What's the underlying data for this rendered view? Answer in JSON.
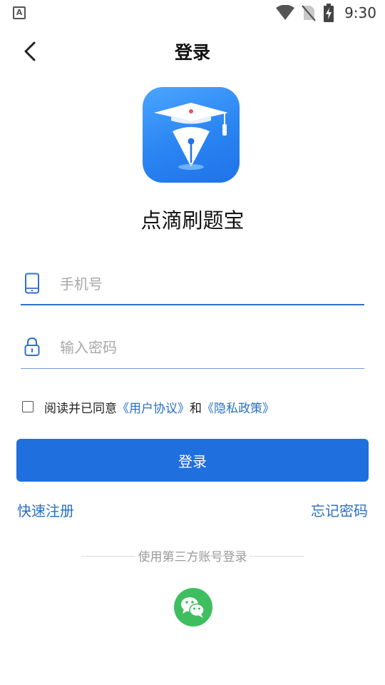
{
  "status_bar": {
    "left_icon_letter": "A",
    "time": "9:30",
    "icons": [
      "wifi-icon",
      "no-sim-icon",
      "battery-charging-icon"
    ]
  },
  "header": {
    "title": "登录",
    "back_icon": "chevron-left-icon"
  },
  "app": {
    "name": "点滴刷题宝",
    "logo_icon": "graduation-cap-pen-icon"
  },
  "form": {
    "phone": {
      "placeholder": "手机号",
      "value": "",
      "icon": "phone-icon"
    },
    "password": {
      "placeholder": "输入密码",
      "value": "",
      "icon": "lock-icon"
    }
  },
  "agreement": {
    "checked": false,
    "prefix": "阅读并已同意",
    "user_agreement": "《用户协议》",
    "connector": "和",
    "privacy_policy": "《隐私政策》"
  },
  "actions": {
    "login_label": "登录",
    "register_label": "快速注册",
    "forgot_label": "忘记密码"
  },
  "third_party": {
    "label": "使用第三方账号登录",
    "wechat_icon": "wechat-icon"
  },
  "colors": {
    "primary": "#1f6fdf",
    "link": "#2a6fc4",
    "wechat": "#3fbe5f"
  }
}
